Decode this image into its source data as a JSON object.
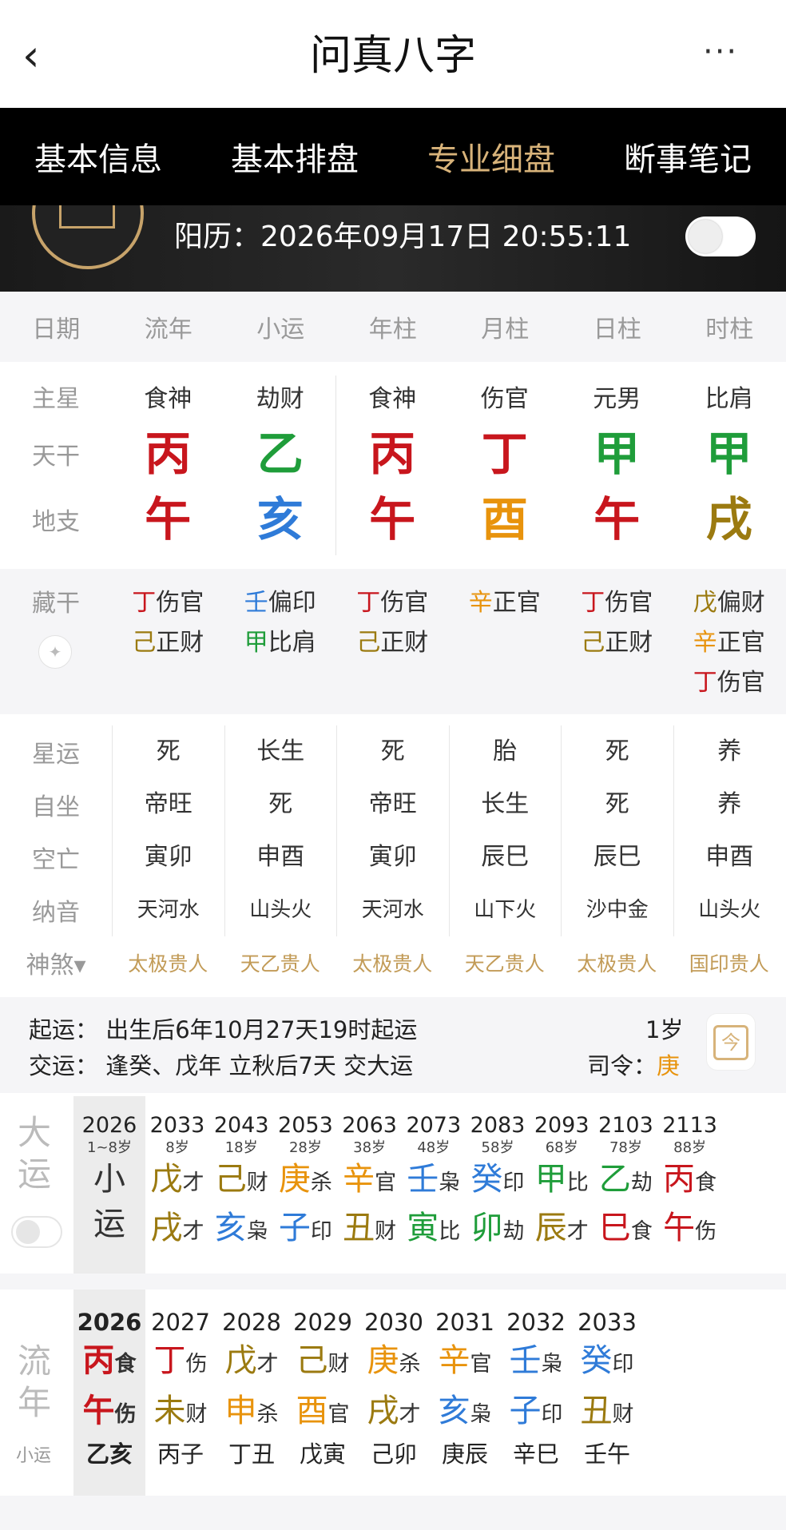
{
  "nav": {
    "title": "问真八字",
    "back_icon": "‹",
    "more_icon": "···"
  },
  "tabs": [
    "基本信息",
    "基本排盘",
    "专业细盘",
    "断事笔记"
  ],
  "active_tab": 2,
  "hero": {
    "solar_label": "阳历：2026年09月17日 20:55:11"
  },
  "columns": [
    "日期",
    "流年",
    "小运",
    "年柱",
    "月柱",
    "日柱",
    "时柱"
  ],
  "pillars": {
    "labels": {
      "main": "主星",
      "stem": "天干",
      "branch": "地支"
    },
    "main": [
      "食神",
      "劫财",
      "食神",
      "伤官",
      "元男",
      "比肩"
    ],
    "stems": [
      {
        "c": "丙",
        "color": "red"
      },
      {
        "c": "乙",
        "color": "green"
      },
      {
        "c": "丙",
        "color": "red"
      },
      {
        "c": "丁",
        "color": "red"
      },
      {
        "c": "甲",
        "color": "green"
      },
      {
        "c": "甲",
        "color": "green"
      }
    ],
    "branches": [
      {
        "c": "午",
        "color": "red"
      },
      {
        "c": "亥",
        "color": "blue"
      },
      {
        "c": "午",
        "color": "red"
      },
      {
        "c": "酉",
        "color": "orange"
      },
      {
        "c": "午",
        "color": "red"
      },
      {
        "c": "戌",
        "color": "olive"
      }
    ]
  },
  "hidden": {
    "label": "藏干",
    "cols": [
      [
        {
          "g": "丁",
          "t": "伤官",
          "color": "red"
        },
        {
          "g": "己",
          "t": "正财",
          "color": "olive"
        }
      ],
      [
        {
          "g": "壬",
          "t": "偏印",
          "color": "blue"
        },
        {
          "g": "甲",
          "t": "比肩",
          "color": "green"
        }
      ],
      [
        {
          "g": "丁",
          "t": "伤官",
          "color": "red"
        },
        {
          "g": "己",
          "t": "正财",
          "color": "olive"
        }
      ],
      [
        {
          "g": "辛",
          "t": "正官",
          "color": "orange"
        }
      ],
      [
        {
          "g": "丁",
          "t": "伤官",
          "color": "red"
        },
        {
          "g": "己",
          "t": "正财",
          "color": "olive"
        }
      ],
      [
        {
          "g": "戊",
          "t": "偏财",
          "color": "olive"
        },
        {
          "g": "辛",
          "t": "正官",
          "color": "orange"
        },
        {
          "g": "丁",
          "t": "伤官",
          "color": "red"
        }
      ]
    ]
  },
  "table": {
    "rows": [
      {
        "label": "星运",
        "vals": [
          "死",
          "长生",
          "死",
          "胎",
          "死",
          "养"
        ]
      },
      {
        "label": "自坐",
        "vals": [
          "帝旺",
          "死",
          "帝旺",
          "长生",
          "死",
          "养"
        ]
      },
      {
        "label": "空亡",
        "vals": [
          "寅卯",
          "申酉",
          "寅卯",
          "辰巳",
          "辰巳",
          "申酉"
        ]
      },
      {
        "label": "纳音",
        "vals": [
          "天河水",
          "山头火",
          "天河水",
          "山下火",
          "沙中金",
          "山头火"
        ]
      }
    ],
    "shensha_label": "神煞▾",
    "shensha": [
      "太极贵人",
      "天乙贵人",
      "太极贵人",
      "天乙贵人",
      "太极贵人",
      "国印贵人"
    ]
  },
  "luck": {
    "line1": "起运：  出生后6年10月27天19时起运",
    "line2": "交运：  逢癸、戊年 立秋后7天 交大运",
    "age": "1岁",
    "siling_label": "司令：",
    "siling_value": "庚",
    "cal_icon": "今"
  },
  "dayun": {
    "label": "大运",
    "first": {
      "year": "2026",
      "age": "1~8岁",
      "a": "小",
      "b": "运"
    },
    "items": [
      {
        "year": "2033",
        "age": "8岁",
        "s": "戊",
        "sc": "olive",
        "st": "才",
        "b": "戌",
        "bc": "olive",
        "bt": "才"
      },
      {
        "year": "2043",
        "age": "18岁",
        "s": "己",
        "sc": "olive",
        "st": "财",
        "b": "亥",
        "bc": "blue",
        "bt": "枭"
      },
      {
        "year": "2053",
        "age": "28岁",
        "s": "庚",
        "sc": "orange",
        "st": "杀",
        "b": "子",
        "bc": "blue",
        "bt": "印"
      },
      {
        "year": "2063",
        "age": "38岁",
        "s": "辛",
        "sc": "orange",
        "st": "官",
        "b": "丑",
        "bc": "olive",
        "bt": "财"
      },
      {
        "year": "2073",
        "age": "48岁",
        "s": "壬",
        "sc": "blue",
        "st": "枭",
        "b": "寅",
        "bc": "green",
        "bt": "比"
      },
      {
        "year": "2083",
        "age": "58岁",
        "s": "癸",
        "sc": "blue",
        "st": "印",
        "b": "卯",
        "bc": "green",
        "bt": "劫"
      },
      {
        "year": "2093",
        "age": "68岁",
        "s": "甲",
        "sc": "green",
        "st": "比",
        "b": "辰",
        "bc": "olive",
        "bt": "才"
      },
      {
        "year": "2103",
        "age": "78岁",
        "s": "乙",
        "sc": "green",
        "st": "劫",
        "b": "巳",
        "bc": "red",
        "bt": "食"
      },
      {
        "year": "2113",
        "age": "88岁",
        "s": "丙",
        "sc": "red",
        "st": "食",
        "b": "午",
        "bc": "red",
        "bt": "伤"
      }
    ]
  },
  "liunian": {
    "label": "流年",
    "sub": "小运",
    "items": [
      {
        "year": "2026",
        "s": "丙",
        "sc": "red",
        "st": "食",
        "b": "午",
        "bc": "red",
        "bt": "伤",
        "gz": "乙亥",
        "bold": true
      },
      {
        "year": "2027",
        "s": "丁",
        "sc": "red",
        "st": "伤",
        "b": "未",
        "bc": "olive",
        "bt": "财",
        "gz": "丙子"
      },
      {
        "year": "2028",
        "s": "戊",
        "sc": "olive",
        "st": "才",
        "b": "申",
        "bc": "orange",
        "bt": "杀",
        "gz": "丁丑"
      },
      {
        "year": "2029",
        "s": "己",
        "sc": "olive",
        "st": "财",
        "b": "酉",
        "bc": "orange",
        "bt": "官",
        "gz": "戊寅"
      },
      {
        "year": "2030",
        "s": "庚",
        "sc": "orange",
        "st": "杀",
        "b": "戌",
        "bc": "olive",
        "bt": "才",
        "gz": "己卯"
      },
      {
        "year": "2031",
        "s": "辛",
        "sc": "orange",
        "st": "官",
        "b": "亥",
        "bc": "blue",
        "bt": "枭",
        "gz": "庚辰"
      },
      {
        "year": "2032",
        "s": "壬",
        "sc": "blue",
        "st": "枭",
        "b": "子",
        "bc": "blue",
        "bt": "印",
        "gz": "辛巳"
      },
      {
        "year": "2033",
        "s": "癸",
        "sc": "blue",
        "st": "印",
        "b": "丑",
        "bc": "olive",
        "bt": "财",
        "gz": "壬午"
      }
    ]
  }
}
